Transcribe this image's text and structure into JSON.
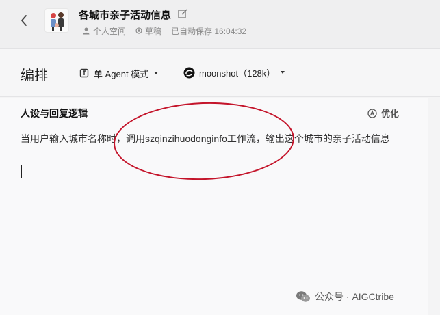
{
  "header": {
    "title": "各城市亲子活动信息",
    "space": "个人空间",
    "status": "草稿",
    "autosave": "已自动保存 16:04:32"
  },
  "toolbar": {
    "arrange_label": "编排",
    "mode": "单 Agent 模式",
    "model": "moonshot（128k）"
  },
  "prompt_section": {
    "title": "人设与回复逻辑",
    "optimize_label": "优化",
    "text": "当用户输入城市名称时，调用szqinzihuodonginfo工作流，输出这个城市的亲子活动信息"
  },
  "watermark": {
    "text": "公众号 · AIGCtribe"
  },
  "colors": {
    "annotation": "#c4142a"
  }
}
